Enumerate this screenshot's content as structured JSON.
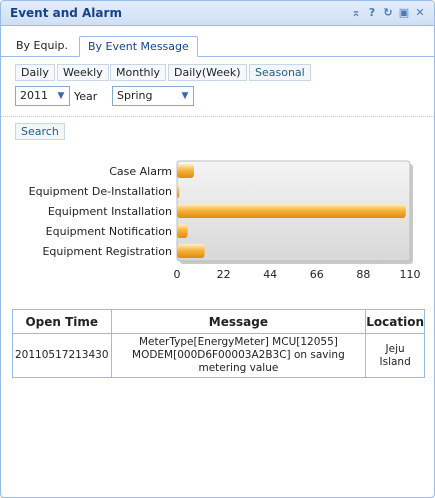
{
  "window": {
    "title": "Event and Alarm"
  },
  "toolbar_icons": [
    "collapse-icon",
    "help-icon",
    "refresh-icon",
    "maximize-icon",
    "close-icon"
  ],
  "tabs": [
    {
      "label": "By Equip.",
      "active": false
    },
    {
      "label": "By Event Message",
      "active": true
    }
  ],
  "period_buttons": [
    {
      "label": "Daily"
    },
    {
      "label": "Weekly"
    },
    {
      "label": "Monthly"
    },
    {
      "label": "Daily(Week)"
    },
    {
      "label": "Seasonal",
      "active": true
    }
  ],
  "filters": {
    "year_value": "2011",
    "year_label": "Year",
    "season_value": "Spring"
  },
  "search_label": "Search",
  "chart_data": {
    "type": "bar",
    "orientation": "horizontal",
    "categories": [
      "Case Alarm",
      "Equipment De-Installation",
      "Equipment Installation",
      "Equipment Notification",
      "Equipment Registration"
    ],
    "values": [
      8,
      1,
      108,
      5,
      13
    ],
    "xlim": [
      0,
      110
    ],
    "x_ticks": [
      0,
      22,
      44,
      66,
      88,
      110
    ],
    "bar_color": "#f5a623",
    "grid": false
  },
  "table": {
    "columns": [
      "Open Time",
      "Message",
      "Location"
    ],
    "rows": [
      {
        "open_time": "20110517213430",
        "message_line1": "MeterType[EnergyMeter] MCU[12055]",
        "message_line2": "MODEM[000D6F00003A2B3C] on saving",
        "message_line3": "metering value",
        "location_line1": "Jeju",
        "location_line2": "Island"
      }
    ]
  }
}
